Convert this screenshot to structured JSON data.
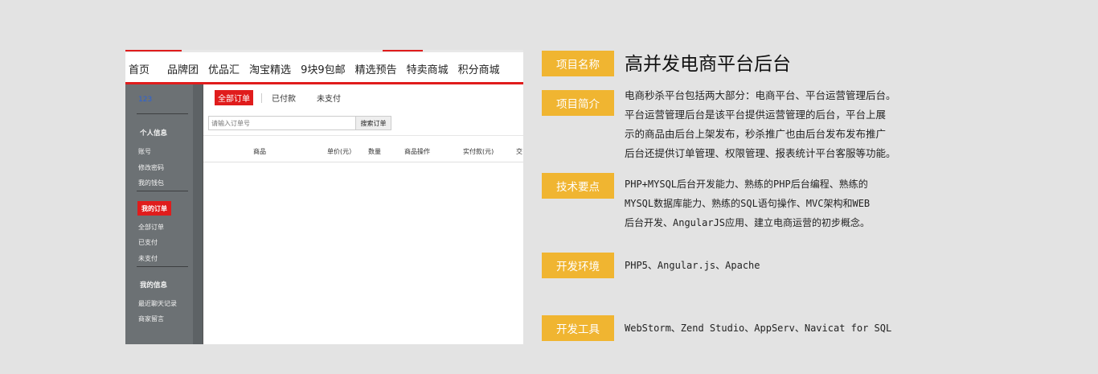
{
  "screenshot": {
    "nav_items": [
      "首页",
      "品牌团",
      "优品汇",
      "淘宝精选",
      "9块9包邮",
      "精选预告",
      "特卖商城",
      "积分商城"
    ],
    "sidebar": {
      "user": "123",
      "section_personal": "个人信息",
      "personal_links": [
        "账号",
        "修改密码",
        "我的钱包"
      ],
      "active_item": "我的订单",
      "order_links": [
        "全部订单",
        "已支付",
        "未支付"
      ],
      "section_info": "我的信息",
      "info_links": [
        "最近聊天记录",
        "商家留言"
      ]
    },
    "tabs": [
      "全部订单",
      "已付款",
      "未支付"
    ],
    "search": {
      "placeholder": "请输入订单号",
      "button": "搜索订单"
    },
    "table_headers": [
      "商品",
      "单价(元）",
      "数量",
      "商品操作",
      "实付款(元)",
      "交"
    ]
  },
  "info": {
    "name_tag": "项目名称",
    "title": "高并发电商平台后台",
    "intro_tag": "项目简介",
    "intro_lines": [
      "电商秒杀平台包括两大部分：电商平台、平台运营管理后台。",
      "平台运营管理后台是该平台提供运营管理的后台，平台上展",
      "示的商品由后台上架发布，秒杀推广也由后台发布发布推广",
      "后台还提供订单管理、权限管理、报表统计平台客服等功能。"
    ],
    "tech_tag": "技术要点",
    "tech_lines": [
      "PHP+MYSQL后台开发能力、熟练的PHP后台编程、熟练的",
      "MYSQL数据库能力、熟练的SQL语句操作、MVC架构和WEB",
      "后台开发、AngularJS应用、建立电商运营的初步概念。"
    ],
    "env_tag": "开发环境",
    "env": "PHP5、Angular.js、Apache",
    "tools_tag": "开发工具",
    "tools": "WebStorm、Zend Studio、AppServ、Navicat for SQL"
  },
  "colors": {
    "accent_red": "#e01c1c",
    "tag_yellow": "#f0b531",
    "sidebar_gray": "#6c7174"
  }
}
